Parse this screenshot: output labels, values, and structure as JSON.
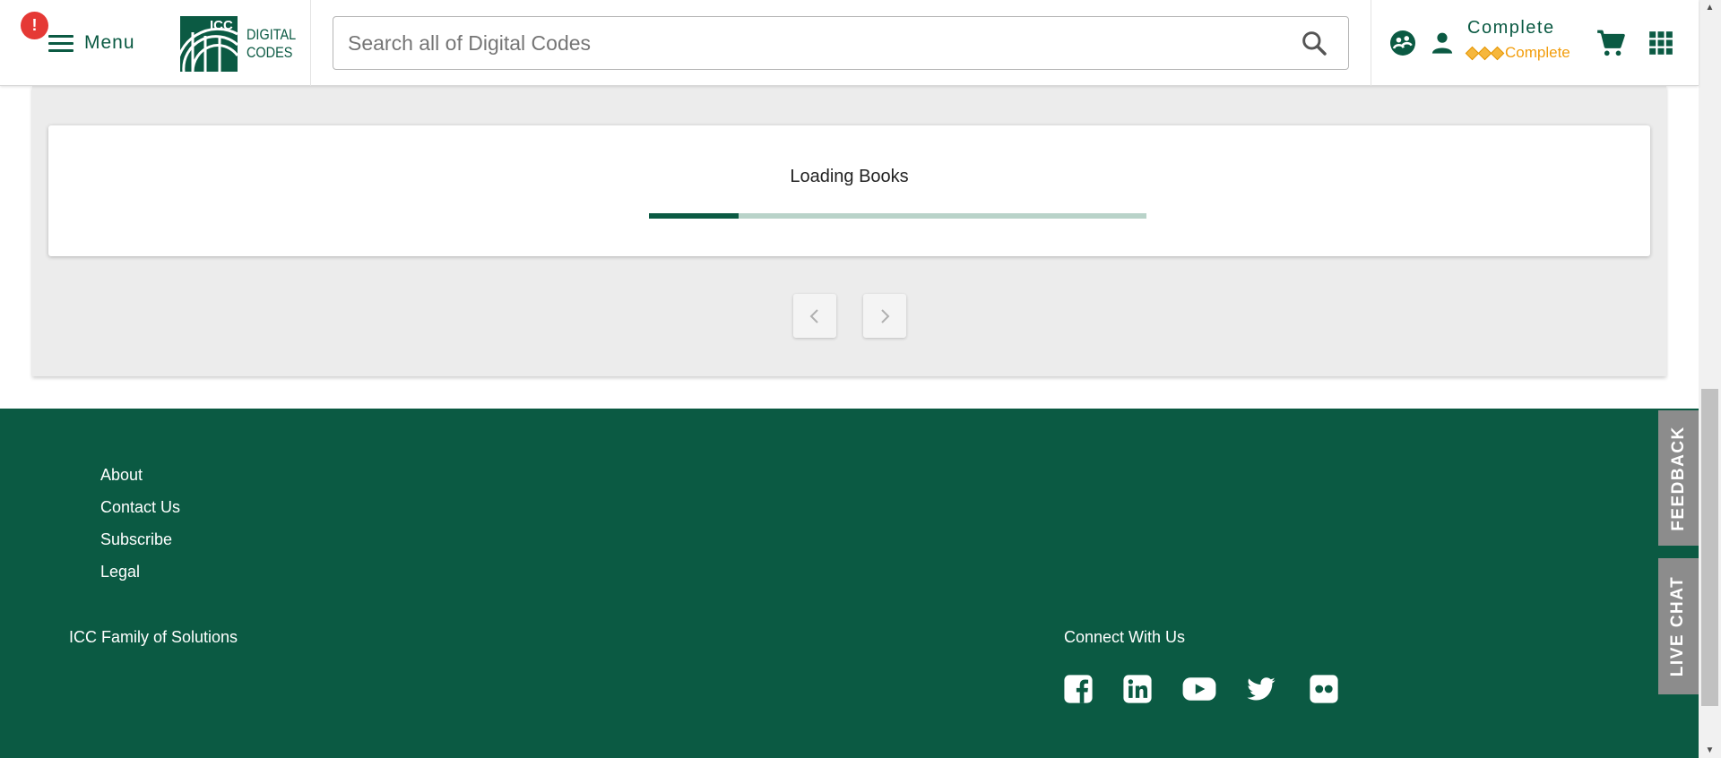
{
  "header": {
    "alert_badge": "!",
    "menu_label": "Menu",
    "logo": {
      "line1": "DIGITAL",
      "line2": "CODES",
      "mark_text": "ICC"
    },
    "search": {
      "placeholder": "Search all of Digital Codes",
      "value": ""
    },
    "user": {
      "name": "Complete",
      "tier": "Complete"
    },
    "icons": [
      "account-switch-icon",
      "person-icon",
      "diamond-icon",
      "cart-icon",
      "apps-grid-icon",
      "search-icon"
    ]
  },
  "main": {
    "loading_text": "Loading Books",
    "progress_fraction": 0.18,
    "pagination": {
      "prev_icon": "chevron-left-icon",
      "next_icon": "chevron-right-icon"
    }
  },
  "footer": {
    "links": [
      "About",
      "Contact Us",
      "Subscribe",
      "Legal"
    ],
    "family_heading": "ICC Family of Solutions",
    "connect_heading": "Connect With Us",
    "social_icons": [
      "facebook-icon",
      "linkedin-icon",
      "youtube-icon",
      "twitter-icon",
      "flickr-icon"
    ]
  },
  "side_tabs": {
    "feedback": "FEEDBACK",
    "live_chat": "LIVE CHAT"
  },
  "colors": {
    "brand_green": "#0b5a43",
    "panel_grey": "#ececec",
    "alert_red": "#e53935",
    "tier_gold": "#f29d0c",
    "tab_grey": "#8c8c8c"
  }
}
